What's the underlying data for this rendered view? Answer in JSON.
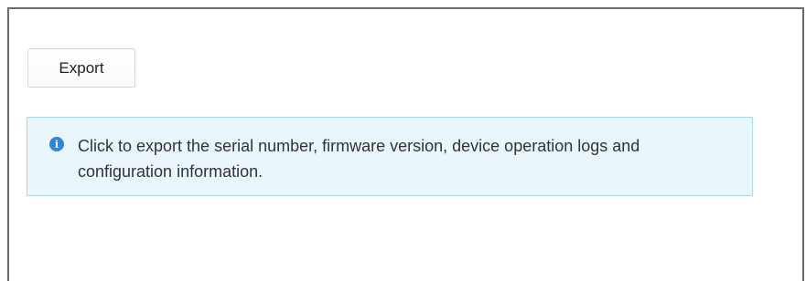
{
  "toolbar": {
    "export_label": "Export"
  },
  "info": {
    "icon": "info-icon",
    "message": "Click to export the serial number, firmware version, device operation logs and configuration information."
  },
  "colors": {
    "info_background": "#e9f6fc",
    "info_border": "#a9d7ec",
    "info_icon": "#2f86d6"
  }
}
